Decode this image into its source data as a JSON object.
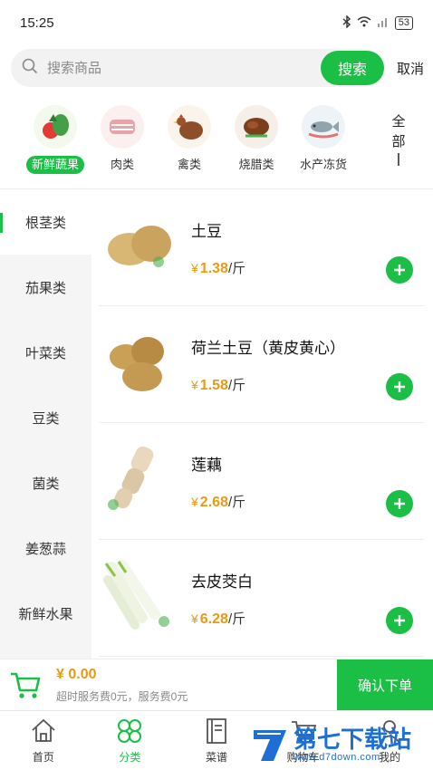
{
  "status": {
    "time": "15:25",
    "battery": "53"
  },
  "search": {
    "placeholder": "搜索商品",
    "button": "搜索",
    "cancel": "取消"
  },
  "categories": [
    {
      "label": "新鲜蔬果",
      "icon": "vegetable-icon",
      "bg": "#f4f9ee"
    },
    {
      "label": "肉类",
      "icon": "meat-icon",
      "bg": "#fbeff0"
    },
    {
      "label": "禽类",
      "icon": "poultry-icon",
      "bg": "#fbf4ea"
    },
    {
      "label": "烧腊类",
      "icon": "roast-meat-icon",
      "bg": "#f6eee8"
    },
    {
      "label": "水产冻货",
      "icon": "seafood-icon",
      "bg": "#eef3f7"
    }
  ],
  "category_all": {
    "line1": "全",
    "line2": "部",
    "line3": "ꟾ"
  },
  "sidebar": {
    "items": [
      "根茎类",
      "茄果类",
      "叶菜类",
      "豆类",
      "菌类",
      "姜葱蒜",
      "新鲜水果"
    ]
  },
  "products": [
    {
      "name": "土豆",
      "currency": "¥",
      "price": "1.38",
      "unit": "/斤",
      "image": "potato-image"
    },
    {
      "name": "荷兰土豆（黄皮黄心）",
      "currency": "¥",
      "price": "1.58",
      "unit": "/斤",
      "image": "dutch-potato-image"
    },
    {
      "name": "莲藕",
      "currency": "¥",
      "price": "2.68",
      "unit": "/斤",
      "image": "lotus-root-image"
    },
    {
      "name": "去皮茭白",
      "currency": "¥",
      "price": "6.28",
      "unit": "/斤",
      "image": "water-bamboo-image"
    }
  ],
  "cart": {
    "total": "¥ 0.00",
    "fee_note": "超时服务费0元，服务费0元",
    "confirm": "确认下单"
  },
  "tabs": [
    {
      "label": "首页",
      "icon": "home-icon"
    },
    {
      "label": "分类",
      "icon": "category-icon"
    },
    {
      "label": "菜谱",
      "icon": "recipe-icon"
    },
    {
      "label": "购物车",
      "icon": "cart-icon"
    },
    {
      "label": "我的",
      "icon": "profile-icon"
    }
  ],
  "watermark": {
    "title": "第七下载站",
    "url": "www.d7down.com"
  },
  "colors": {
    "accent": "#1bbf45",
    "price": "#e99a13",
    "watermark": "#1d6fd6"
  }
}
